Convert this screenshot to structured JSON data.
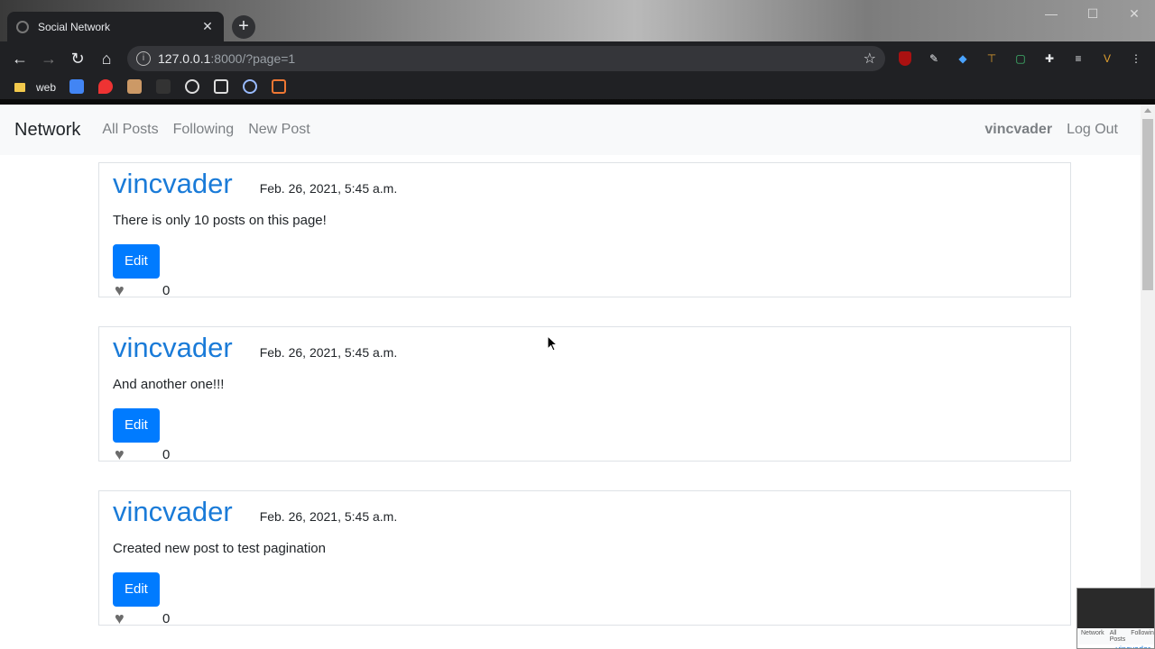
{
  "browser": {
    "tab_title": "Social Network",
    "tab_close": "✕",
    "new_tab": "+",
    "url_host": "127.0.0.1",
    "url_path": ":8000/?page=1",
    "bookmarks": [
      {
        "label": "web"
      }
    ]
  },
  "navbar": {
    "brand": "Network",
    "links": [
      "All Posts",
      "Following",
      "New Post"
    ],
    "username": "vincvader",
    "logout": "Log Out"
  },
  "posts": [
    {
      "author": "vincvader",
      "date": "Feb. 26, 2021, 5:45 a.m.",
      "content": "There is only 10 posts on this page!",
      "edit_label": "Edit",
      "likes": "0"
    },
    {
      "author": "vincvader",
      "date": "Feb. 26, 2021, 5:45 a.m.",
      "content": "And another one!!!",
      "edit_label": "Edit",
      "likes": "0"
    },
    {
      "author": "vincvader",
      "date": "Feb. 26, 2021, 5:45 a.m.",
      "content": "Created new post to test pagination",
      "edit_label": "Edit",
      "likes": "0"
    }
  ],
  "thumbnail": {
    "nav": [
      "Network",
      "All Posts",
      "Following"
    ],
    "user": "vincvader"
  },
  "colors": {
    "link": "#1a7bd8",
    "button": "#007bff",
    "navbar_bg": "#f8f9fa"
  }
}
